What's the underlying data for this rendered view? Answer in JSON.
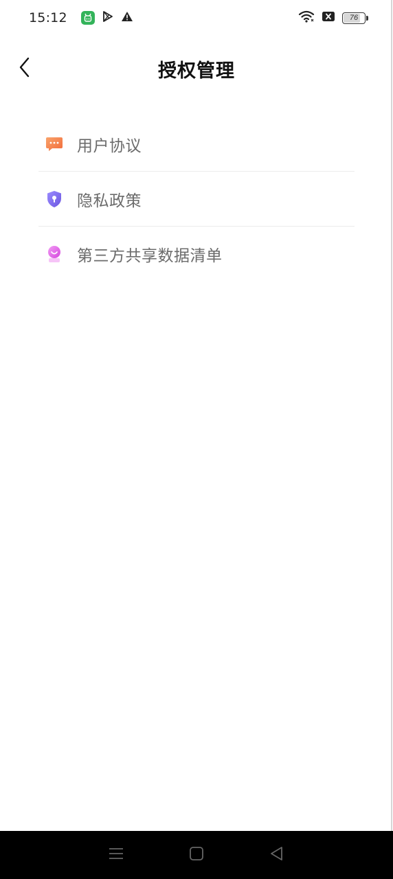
{
  "status_bar": {
    "time": "15:12",
    "battery_level": "76",
    "icons": [
      "app-badge-icon",
      "play-store-icon",
      "warning-icon",
      "wifi-icon",
      "no-sim-icon",
      "battery-icon"
    ]
  },
  "header": {
    "title": "授权管理",
    "back_icon": "chevron-left-icon"
  },
  "menu": {
    "items": [
      {
        "label": "用户协议",
        "icon": "chat-bubble-icon",
        "icon_color": "#f47d4a"
      },
      {
        "label": "隐私政策",
        "icon": "shield-lock-icon",
        "icon_color": "#7b6cf0"
      },
      {
        "label": "第三方共享数据清单",
        "icon": "share-person-icon",
        "icon_color": "#e45ee8"
      }
    ]
  },
  "nav_bar": {
    "icons": [
      "menu-icon",
      "home-icon",
      "back-triangle-icon"
    ]
  }
}
